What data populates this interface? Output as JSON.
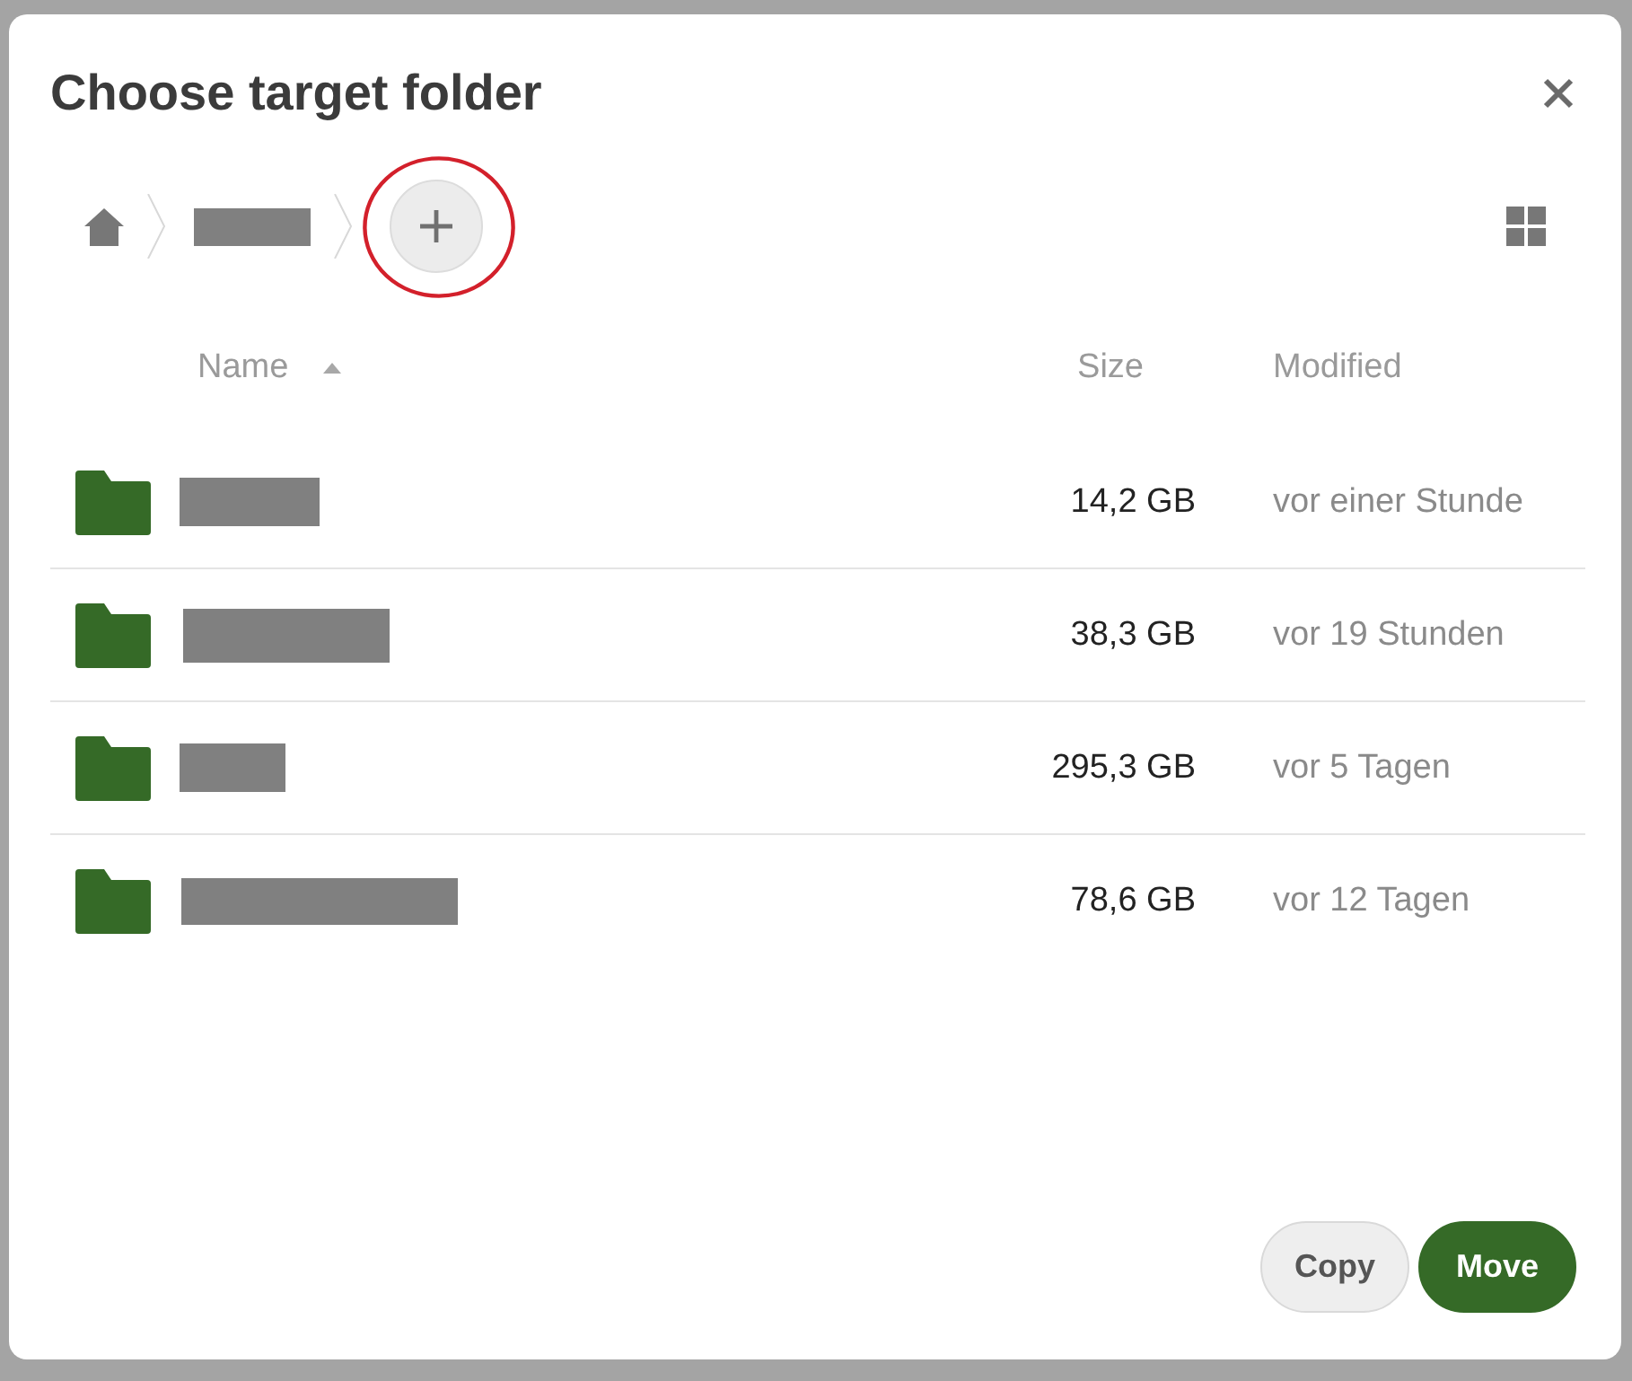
{
  "dialog": {
    "title": "Choose target folder"
  },
  "breadcrumb": {
    "items": [
      {
        "kind": "home"
      },
      {
        "kind": "redacted"
      }
    ],
    "new_folder_button": {
      "highlighted": true
    }
  },
  "table": {
    "columns": [
      {
        "label": "Name",
        "sorted": true
      },
      {
        "label": "Size",
        "sorted": false
      },
      {
        "label": "Modified",
        "sorted": false
      }
    ],
    "rows": [
      {
        "kind": "folder",
        "name_redacted": true,
        "size": "14,2 GB",
        "modified": "vor einer Stunde"
      },
      {
        "kind": "folder",
        "name_redacted": true,
        "size": "38,3 GB",
        "modified": "vor 19 Stunden"
      },
      {
        "kind": "folder",
        "name_redacted": true,
        "size": "295,3 GB",
        "modified": "vor 5 Tagen"
      },
      {
        "kind": "folder",
        "name_redacted": true,
        "size": "78,6 GB",
        "modified": "vor 12 Tagen"
      }
    ]
  },
  "actions": [
    {
      "label": "Copy",
      "kind": "secondary"
    },
    {
      "label": "Move",
      "kind": "primary"
    }
  ]
}
